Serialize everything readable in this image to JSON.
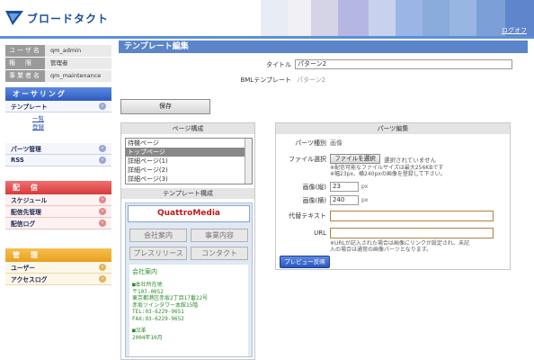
{
  "header": {
    "brand": "ブロードタクト",
    "logout": "ログオフ",
    "bands": [
      "#e8ecf4",
      "#f0f0f5",
      "#d4d4e6",
      "#b6b6e2",
      "#c8d2ec",
      "#9bb6e6",
      "#8aacdc",
      "#98b6e2",
      "#7d9fd8",
      "#5f86cc"
    ]
  },
  "user": {
    "rows": [
      {
        "key": "ユーザ名",
        "value": "qm_admin"
      },
      {
        "key": "権　限",
        "value": "管理者"
      },
      {
        "key": "事業者名",
        "value": "qm_maintenance"
      }
    ]
  },
  "menu": {
    "operating": {
      "title": "オーサリング",
      "items": [
        "テンプレート",
        "パーツ管理",
        "RSS"
      ],
      "subs": [
        "一覧",
        "登録"
      ]
    },
    "delivery": {
      "title": "配　信",
      "items": [
        "スケジュール",
        "配信先管理",
        "配信ログ"
      ]
    },
    "admin": {
      "title": "管　理",
      "items": [
        "ユーザー",
        "アクセスログ"
      ]
    }
  },
  "main": {
    "title": "テンプレート編集",
    "title_label": "タイトル",
    "title_value": "パターン2",
    "bml_label": "BMLテンプレート",
    "bml_value": "パターン2",
    "save": "保存",
    "page_panel": "ページ構成",
    "pages": [
      "待機ページ",
      "トップページ",
      "詳細ページ(1)",
      "詳細ページ(2)",
      "詳細ページ(3)"
    ],
    "template_panel": "テンプレート構成",
    "quattro": "QuattroMedia",
    "tiles": [
      "会社案内",
      "事業内容",
      "プレスリリース",
      "コンタクト"
    ],
    "preview_title": "会社案内",
    "preview_section1": "■本社所在地",
    "preview_lines": [
      "〒107-0052",
      "東京都港区赤坂2丁目17番22号",
      "赤坂ツインタワー本館15階",
      "TEL:03-6229-9651",
      "FAX:03-6229-9652"
    ],
    "preview_section2": "■沿革",
    "preview_year": "2004年10月"
  },
  "parts": {
    "panel": "パーツ編集",
    "type_label": "パーツ種別",
    "type_value": "画像",
    "file_label": "ファイル選択",
    "file_button": "ファイルを選択",
    "file_status": "選択されていません",
    "file_note1": "※配信可能なファイルサイズは最大256KBです",
    "file_note2": "※幅23px、横240pxの画像を登録して下さい。",
    "height_label": "画像(縦)",
    "height_value": "23",
    "height_unit": "px",
    "width_label": "画像(横)",
    "width_value": "240",
    "width_unit": "px",
    "alt_label": "代替テキスト",
    "alt_value": "",
    "url_label": "URL",
    "url_value": "",
    "url_note1": "※URLが記入された場合は画像にリンクが設定され、未記",
    "url_note2": "入の場合は通常の画像パーツとなります。",
    "preview_button": "プレビュー反映"
  }
}
